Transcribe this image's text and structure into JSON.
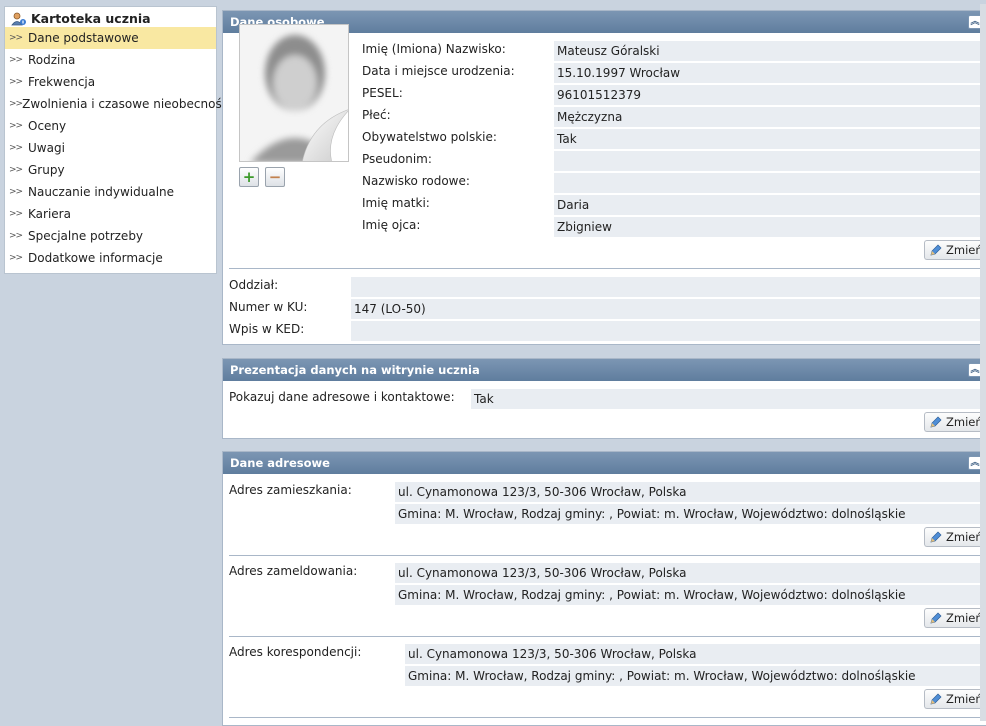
{
  "sidebar": {
    "title": "Kartoteka ucznia",
    "items": [
      {
        "label": "Dane podstawowe",
        "active": true
      },
      {
        "label": "Rodzina"
      },
      {
        "label": "Frekwencja"
      },
      {
        "label": "Zwolnienia i czasowe nieobecności"
      },
      {
        "label": "Oceny"
      },
      {
        "label": "Uwagi"
      },
      {
        "label": "Grupy"
      },
      {
        "label": "Nauczanie indywidualne"
      },
      {
        "label": "Kariera"
      },
      {
        "label": "Specjalne potrzeby"
      },
      {
        "label": "Dodatkowe informacje"
      }
    ]
  },
  "personal": {
    "title": "Dane osobowe",
    "collapse_glyph": "⌃",
    "fields": [
      {
        "label": "Imię (Imiona) Nazwisko:",
        "value": "Mateusz Góralski"
      },
      {
        "label": "Data i miejsce urodzenia:",
        "value": "15.10.1997 Wrocław"
      },
      {
        "label": "PESEL:",
        "value": "96101512379"
      },
      {
        "label": "Płeć:",
        "value": "Mężczyzna"
      },
      {
        "label": "Obywatelstwo polskie:",
        "value": "Tak"
      },
      {
        "label": "Pseudonim:",
        "value": ""
      },
      {
        "label": "Nazwisko rodowe:",
        "value": ""
      },
      {
        "label": "Imię matki:",
        "value": "Daria"
      },
      {
        "label": "Imię ojca:",
        "value": "Zbigniew"
      }
    ],
    "change_label": "Zmień",
    "photo_add": "+",
    "photo_remove": "−",
    "class_fields": [
      {
        "label": "Oddział:",
        "value": ""
      },
      {
        "label": "Numer w KU:",
        "value": "147 (LO-50)"
      },
      {
        "label": "Wpis w KED:",
        "value": ""
      }
    ]
  },
  "presentation": {
    "title": "Prezentacja danych na witrynie ucznia",
    "label": "Pokazuj dane adresowe i kontaktowe:",
    "value": "Tak",
    "change_label": "Zmień"
  },
  "address": {
    "title": "Dane adresowe",
    "blocks": [
      {
        "label": "Adres zamieszkania:",
        "line1": "ul. Cynamonowa 123/3, 50-306 Wrocław, Polska",
        "line2": "Gmina: M. Wrocław, Rodzaj gminy: , Powiat: m. Wrocław, Województwo: dolnośląskie"
      },
      {
        "label": "Adres zameldowania:",
        "line1": "ul. Cynamonowa 123/3, 50-306 Wrocław, Polska",
        "line2": "Gmina: M. Wrocław, Rodzaj gminy: , Powiat: m. Wrocław, Województwo: dolnośląskie"
      },
      {
        "label": "Adres korespondencji:",
        "line1": "ul. Cynamonowa 123/3, 50-306 Wrocław, Polska",
        "line2": "Gmina: M. Wrocław, Rodzaj gminy: , Powiat: m. Wrocław, Województwo: dolnośląskie"
      }
    ],
    "change_label": "Zmień"
  },
  "colors": {
    "header": "#6a87a8",
    "active_item": "#f9e8a2",
    "value_bg": "#e9edf2",
    "background": "#c9d3df"
  }
}
